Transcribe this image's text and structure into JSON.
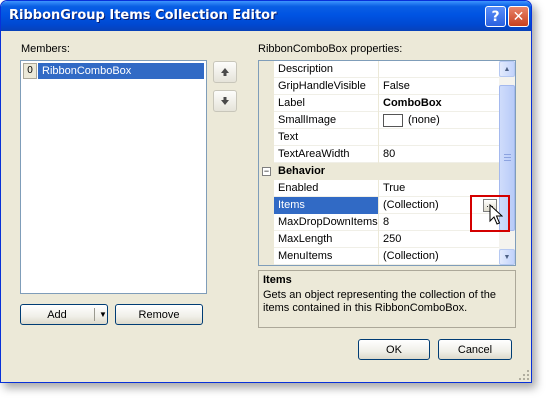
{
  "window": {
    "title": "RibbonGroup Items Collection Editor",
    "help_glyph": "?",
    "close_glyph": "✕"
  },
  "members": {
    "label": "Members:",
    "items": [
      {
        "index": "0",
        "name": "RibbonComboBox",
        "selected": true
      }
    ],
    "add_label": "Add",
    "remove_label": "Remove"
  },
  "properties": {
    "label": "RibbonComboBox properties:",
    "rows_top": [
      {
        "name": "Description",
        "value": ""
      },
      {
        "name": "GripHandleVisible",
        "value": "False"
      },
      {
        "name": "Label",
        "value": "ComboBox"
      },
      {
        "name": "SmallImage",
        "value": "(none)"
      },
      {
        "name": "Text",
        "value": ""
      },
      {
        "name": "TextAreaWidth",
        "value": "80"
      }
    ],
    "category": {
      "name": "Behavior",
      "expander": "−"
    },
    "rows_bottom": [
      {
        "name": "Enabled",
        "value": "True"
      },
      {
        "name": "Items",
        "value": "(Collection)"
      },
      {
        "name": "MaxDropDownItems",
        "value": "8"
      },
      {
        "name": "MaxLength",
        "value": "250"
      },
      {
        "name": "MenuItems",
        "value": "(Collection)"
      }
    ],
    "ellipsis_label": "..."
  },
  "description": {
    "title": "Items",
    "text": "Gets an object representing the collection of the items contained in this RibbonComboBox."
  },
  "footer": {
    "ok_label": "OK",
    "cancel_label": "Cancel"
  },
  "colors": {
    "titlebar": "#0054e3",
    "selection": "#316ac5",
    "dialog_bg": "#ece9d8",
    "highlight": "#d40000"
  },
  "icons": [
    "help-icon",
    "close-icon",
    "move-up-icon",
    "move-down-icon",
    "dropdown-caret-icon",
    "mouse-cursor-icon"
  ]
}
